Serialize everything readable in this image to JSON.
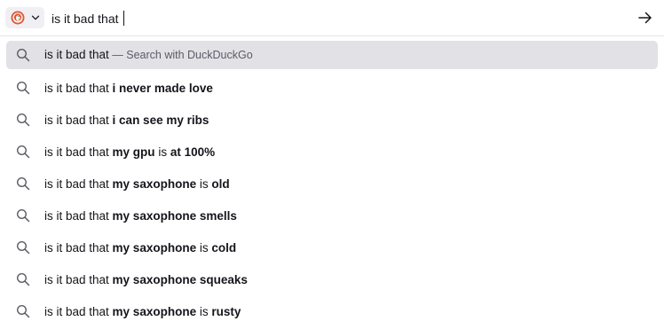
{
  "urlbar": {
    "engine": "DuckDuckGo",
    "engine_icon": "duckduckgo-logo-icon",
    "query": "is it bad that ",
    "go_icon": "arrow-right-icon"
  },
  "suggestions": [
    {
      "prefix": "is it bad that",
      "dash": " — ",
      "action": "Search with DuckDuckGo",
      "selected": true
    },
    {
      "prefix": "is it bad that ",
      "parts": [
        {
          "t": "i never made love",
          "b": true
        }
      ]
    },
    {
      "prefix": "is it bad that ",
      "parts": [
        {
          "t": "i can see my ribs",
          "b": true
        }
      ]
    },
    {
      "prefix": "is it bad that ",
      "parts": [
        {
          "t": "my gpu",
          "b": true
        },
        {
          "t": " is ",
          "b": false
        },
        {
          "t": "at 100%",
          "b": true
        }
      ]
    },
    {
      "prefix": "is it bad that ",
      "parts": [
        {
          "t": "my saxophone",
          "b": true
        },
        {
          "t": " is ",
          "b": false
        },
        {
          "t": "old",
          "b": true
        }
      ]
    },
    {
      "prefix": "is it bad that ",
      "parts": [
        {
          "t": "my saxophone smells",
          "b": true
        }
      ]
    },
    {
      "prefix": "is it bad that ",
      "parts": [
        {
          "t": "my saxophone",
          "b": true
        },
        {
          "t": " is ",
          "b": false
        },
        {
          "t": "cold",
          "b": true
        }
      ]
    },
    {
      "prefix": "is it bad that ",
      "parts": [
        {
          "t": "my saxophone squeaks",
          "b": true
        }
      ]
    },
    {
      "prefix": "is it bad that ",
      "parts": [
        {
          "t": "my saxophone",
          "b": true
        },
        {
          "t": " is ",
          "b": false
        },
        {
          "t": "rusty",
          "b": true
        }
      ]
    }
  ]
}
